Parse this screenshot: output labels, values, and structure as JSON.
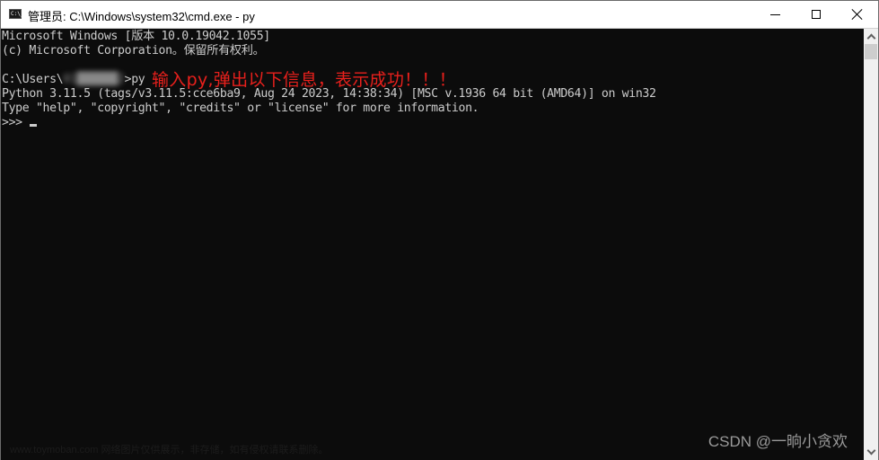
{
  "window": {
    "title": "管理员: C:\\Windows\\system32\\cmd.exe - py",
    "icon": "cmd-icon",
    "controls": {
      "minimize": "minimize-icon",
      "maximize": "maximize-icon",
      "close": "close-icon"
    }
  },
  "console": {
    "lines": [
      "Microsoft Windows [版本 10.0.19042.1055]",
      "(c) Microsoft Corporation。保留所有权利。",
      "",
      "C:\\Users\\",
      "Python 3.11.5 (tags/v3.11.5:cce6ba9, Aug 24 2023, 14:38:34) [MSC v.1936 64 bit (AMD64)] on win32",
      "Type \"help\", \"copyright\", \"credits\" or \"license\" for more information.",
      ">>> "
    ],
    "username_redacted": "01██████2",
    "command_suffix": ">py",
    "prompt": ">>> "
  },
  "annotation": {
    "text": "输入py,弹出以下信息，表示成功！！！",
    "color": "#e8201c"
  },
  "watermarks": {
    "author": "CSDN @一晌小贪欢",
    "site": "www.toymoban.com 网络图片仅供展示，非存储，如有侵权请联系删除。"
  },
  "colors": {
    "console_bg": "#0c0c0c",
    "console_fg": "#cccccc",
    "titlebar_bg": "#ffffff"
  }
}
